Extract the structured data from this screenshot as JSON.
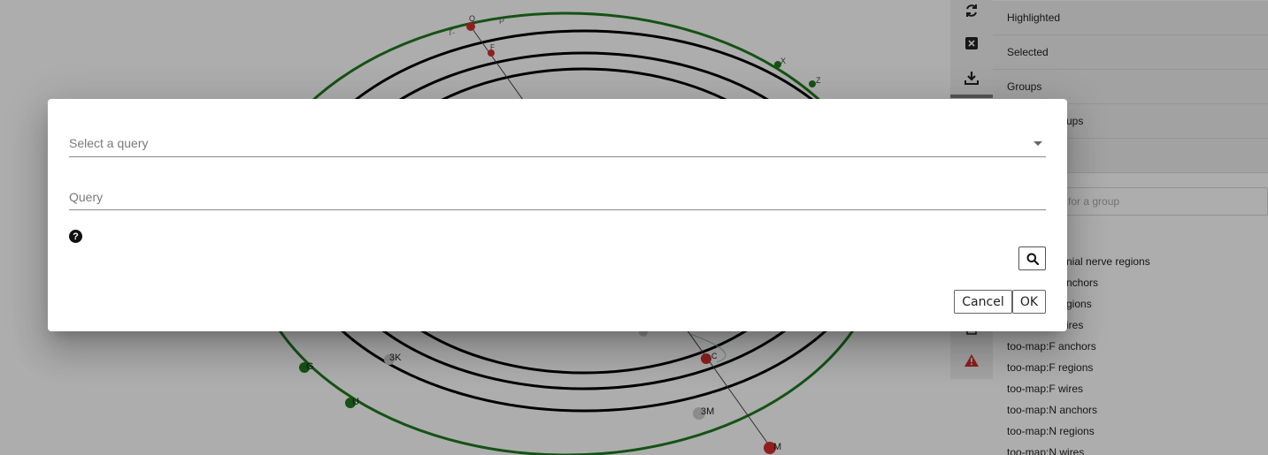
{
  "canvas": {
    "node_labels": [
      "Q",
      "P",
      "T-",
      "F",
      "X",
      "Z",
      "G",
      "U",
      "3K",
      "C",
      "3M",
      "M"
    ]
  },
  "toolbar": {
    "icons": [
      "refresh-icon",
      "close-box-icon",
      "download-icon",
      "clipboard-icon",
      "warning-icon"
    ]
  },
  "side_panel": {
    "sections": [
      "Highlighted",
      "Selected",
      "Groups",
      "ups"
    ],
    "search_placeholder": "for a group",
    "groups": [
      "nial nerve regions",
      "nchors",
      "gions",
      "ires",
      "too-map:F anchors",
      "too-map:F regions",
      "too-map:F wires",
      "too-map:N anchors",
      "too-map:N regions",
      "too-map:N wires"
    ]
  },
  "dialog": {
    "select_label": "Select a query",
    "query_label": "Query",
    "help_symbol": "?",
    "cancel_label": "Cancel",
    "ok_label": "OK"
  },
  "colors": {
    "overlay": "#000000",
    "green_orbit": "#1f7a1f",
    "red_node": "#d32f2f",
    "warning": "#d32f2f"
  }
}
